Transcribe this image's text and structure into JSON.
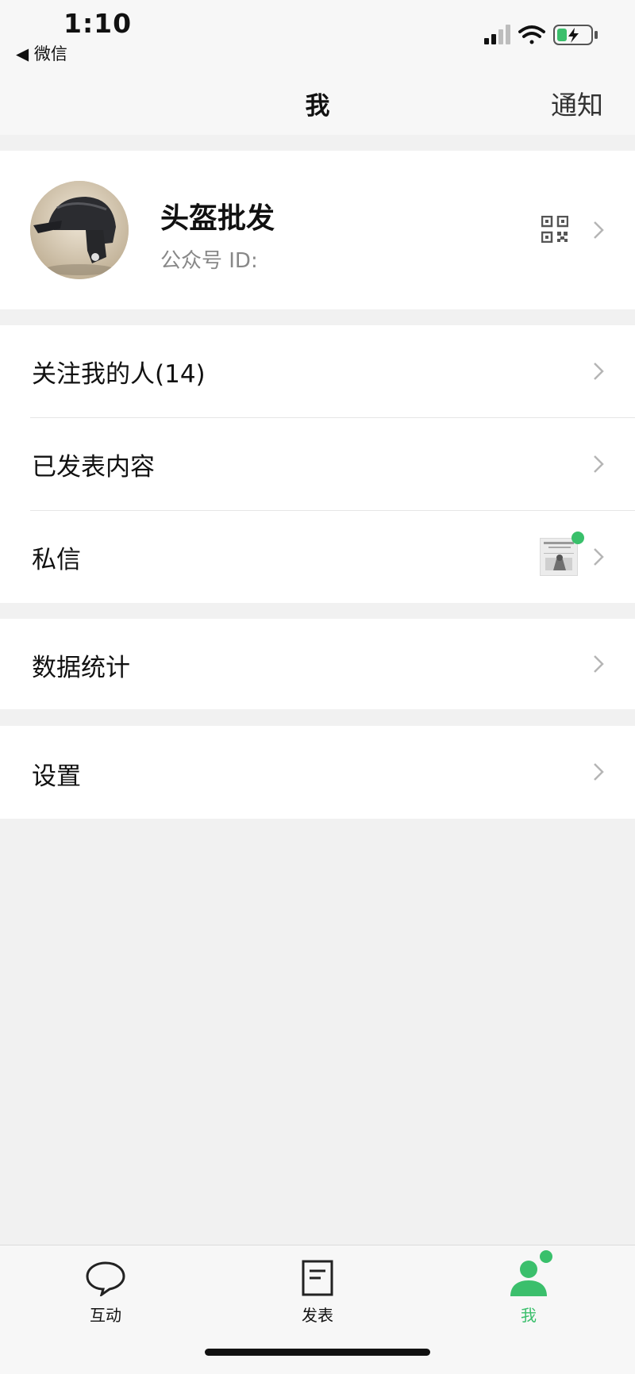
{
  "status_bar": {
    "time": "1:10",
    "back_label": "◀ 微信"
  },
  "nav": {
    "title": "我",
    "right_action": "通知"
  },
  "profile": {
    "name": "头盔批发",
    "account_id_label": "公众号 ID:",
    "icons": {
      "avatar": "helmet-avatar",
      "qr": "qr-code-icon",
      "chevron": "chevron-right-icon"
    }
  },
  "menu": {
    "followers": "关注我的人(14)",
    "published": "已发表内容",
    "messages": "私信",
    "statistics": "数据统计",
    "settings": "设置"
  },
  "tabs": [
    {
      "label": "互动",
      "icon": "chat-bubble-icon",
      "active": false
    },
    {
      "label": "发表",
      "icon": "document-icon",
      "active": false
    },
    {
      "label": "我",
      "icon": "person-icon",
      "active": true
    }
  ],
  "colors": {
    "accent": "#39c06b",
    "background": "#f1f1f1",
    "card": "#ffffff",
    "text_secondary": "#888888"
  }
}
